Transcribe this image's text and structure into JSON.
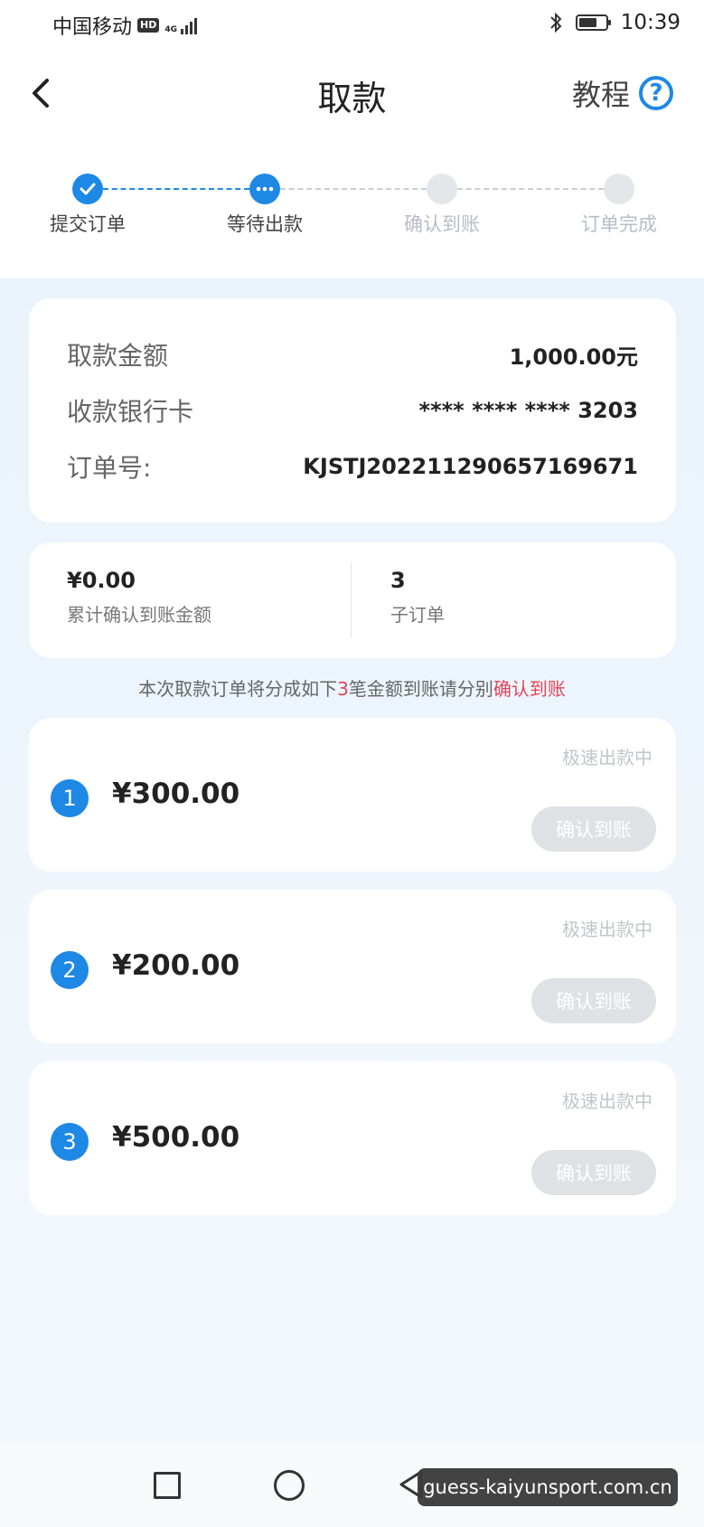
{
  "status_bar": {
    "carrier": "中国移动",
    "hd": "HD",
    "network": "4G",
    "time": "10:39"
  },
  "header": {
    "title": "取款",
    "tutorial_label": "教程",
    "back_icon": "chevron-left-icon",
    "help_icon": "question-circle-icon"
  },
  "steps": [
    {
      "label": "提交订单",
      "state": "done"
    },
    {
      "label": "等待出款",
      "state": "current"
    },
    {
      "label": "确认到账",
      "state": "pending"
    },
    {
      "label": "订单完成",
      "state": "pending"
    }
  ],
  "details": {
    "amount_label": "取款金额",
    "amount_value": "1,000.00元",
    "card_label": "收款银行卡",
    "card_value": "**** **** **** 3203",
    "order_label": "订单号:",
    "order_value": "KJSTJ202211290657169671"
  },
  "summary": {
    "confirmed_value": "¥0.00",
    "confirmed_label": "累计确认到账金额",
    "sub_orders_value": "3",
    "sub_orders_label": "子订单"
  },
  "notice": {
    "prefix": "本次取款订单将分成如下",
    "count": "3",
    "middle": "笔金额到账请分别",
    "link": "确认到账"
  },
  "orders": [
    {
      "index": "1",
      "amount": "¥300.00",
      "status": "极速出款中",
      "button": "确认到账"
    },
    {
      "index": "2",
      "amount": "¥200.00",
      "status": "极速出款中",
      "button": "确认到账"
    },
    {
      "index": "3",
      "amount": "¥500.00",
      "status": "极速出款中",
      "button": "确认到账"
    }
  ],
  "watermark": "guess-kaiyunsport.com.cn",
  "colors": {
    "accent": "#1e88e5",
    "highlight": "#e0455a",
    "disabled_button": "#dfe1e5"
  }
}
